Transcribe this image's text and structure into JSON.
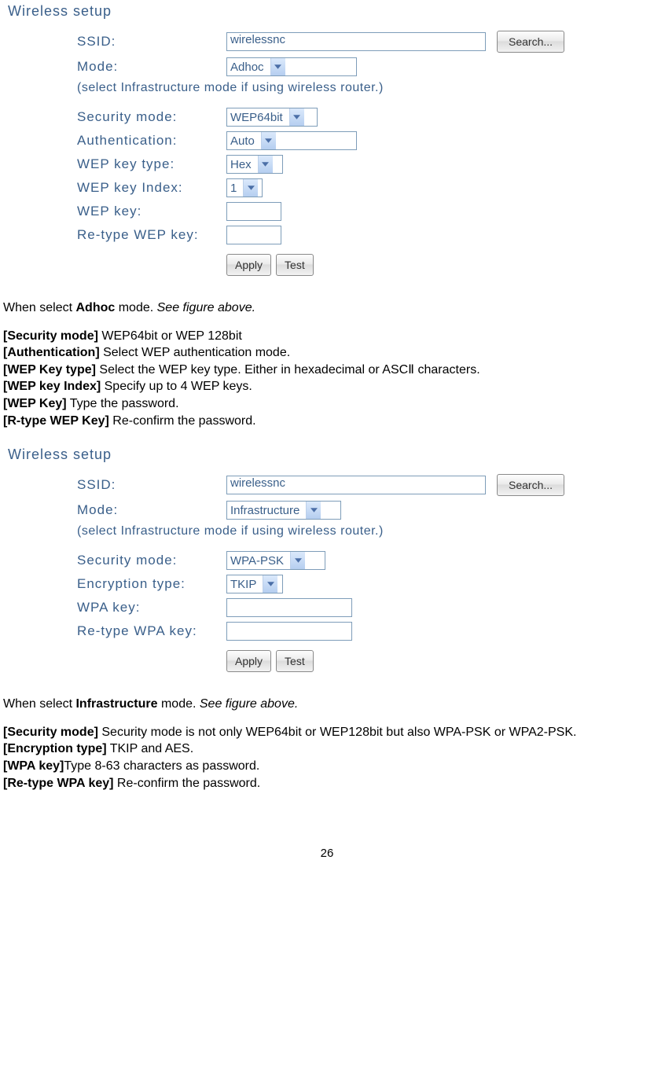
{
  "fig1": {
    "title": "Wireless setup",
    "ssid_label": "SSID:",
    "ssid_value": "wirelessnc",
    "search_label": "Search...",
    "mode_label": "Mode:",
    "mode_value": "Adhoc",
    "hint": "(select Infrastructure mode if using wireless router.)",
    "secmode_label": "Security mode:",
    "secmode_value": "WEP64bit",
    "auth_label": "Authentication:",
    "auth_value": "Auto",
    "keytype_label": "WEP key type:",
    "keytype_value": "Hex",
    "keyidx_label": "WEP key Index:",
    "keyidx_value": "1",
    "wepkey_label": "WEP key:",
    "retype_label": "Re-type WEP key:",
    "apply_label": "Apply",
    "test_label": "Test"
  },
  "text1": {
    "intro_a": "When select ",
    "intro_b": "Adhoc",
    "intro_c": " mode. ",
    "intro_d": "See figure above.",
    "l1a": "[Security mode]",
    "l1b": " WEP64bit or WEP 128bit",
    "l2a": "[Authentication]",
    "l2b": " Select WEP authentication mode.",
    "l3a": "[WEP Key type]",
    "l3b": " Select the WEP key type. Either in hexadecimal or ASCⅡ characters.",
    "l4a": "[WEP key Index]",
    "l4b": " Specify up to 4 WEP keys.",
    "l5a": "[WEP Key]",
    "l5b": " Type the password.",
    "l6a": "[R-type WEP Key]",
    "l6b": " Re-confirm the password."
  },
  "fig2": {
    "title": "Wireless setup",
    "ssid_label": "SSID:",
    "ssid_value": "wirelessnc",
    "search_label": "Search...",
    "mode_label": "Mode:",
    "mode_value": "Infrastructure",
    "hint": "(select Infrastructure mode if using wireless router.)",
    "secmode_label": "Security mode:",
    "secmode_value": "WPA-PSK",
    "enctype_label": "Encryption type:",
    "enctype_value": "TKIP",
    "wpakey_label": "WPA key:",
    "retype_label": "Re-type WPA key:",
    "apply_label": "Apply",
    "test_label": "Test"
  },
  "text2": {
    "intro_a": "When select ",
    "intro_b": "Infrastructure",
    "intro_c": " mode. ",
    "intro_d": "See figure above.",
    "l1a": "[Security mode]",
    "l1b": " Security mode is not only WEP64bit or WEP128bit but also WPA-PSK or WPA2-PSK.",
    "l2a": "[Encryption type]",
    "l2b": " TKIP and AES.",
    "l3a": "[WPA key]",
    "l3b": "Type 8-63 characters as password.",
    "l4a": "[Re-type WPA key]",
    "l4b": " Re-confirm the password."
  },
  "page_number": "26"
}
